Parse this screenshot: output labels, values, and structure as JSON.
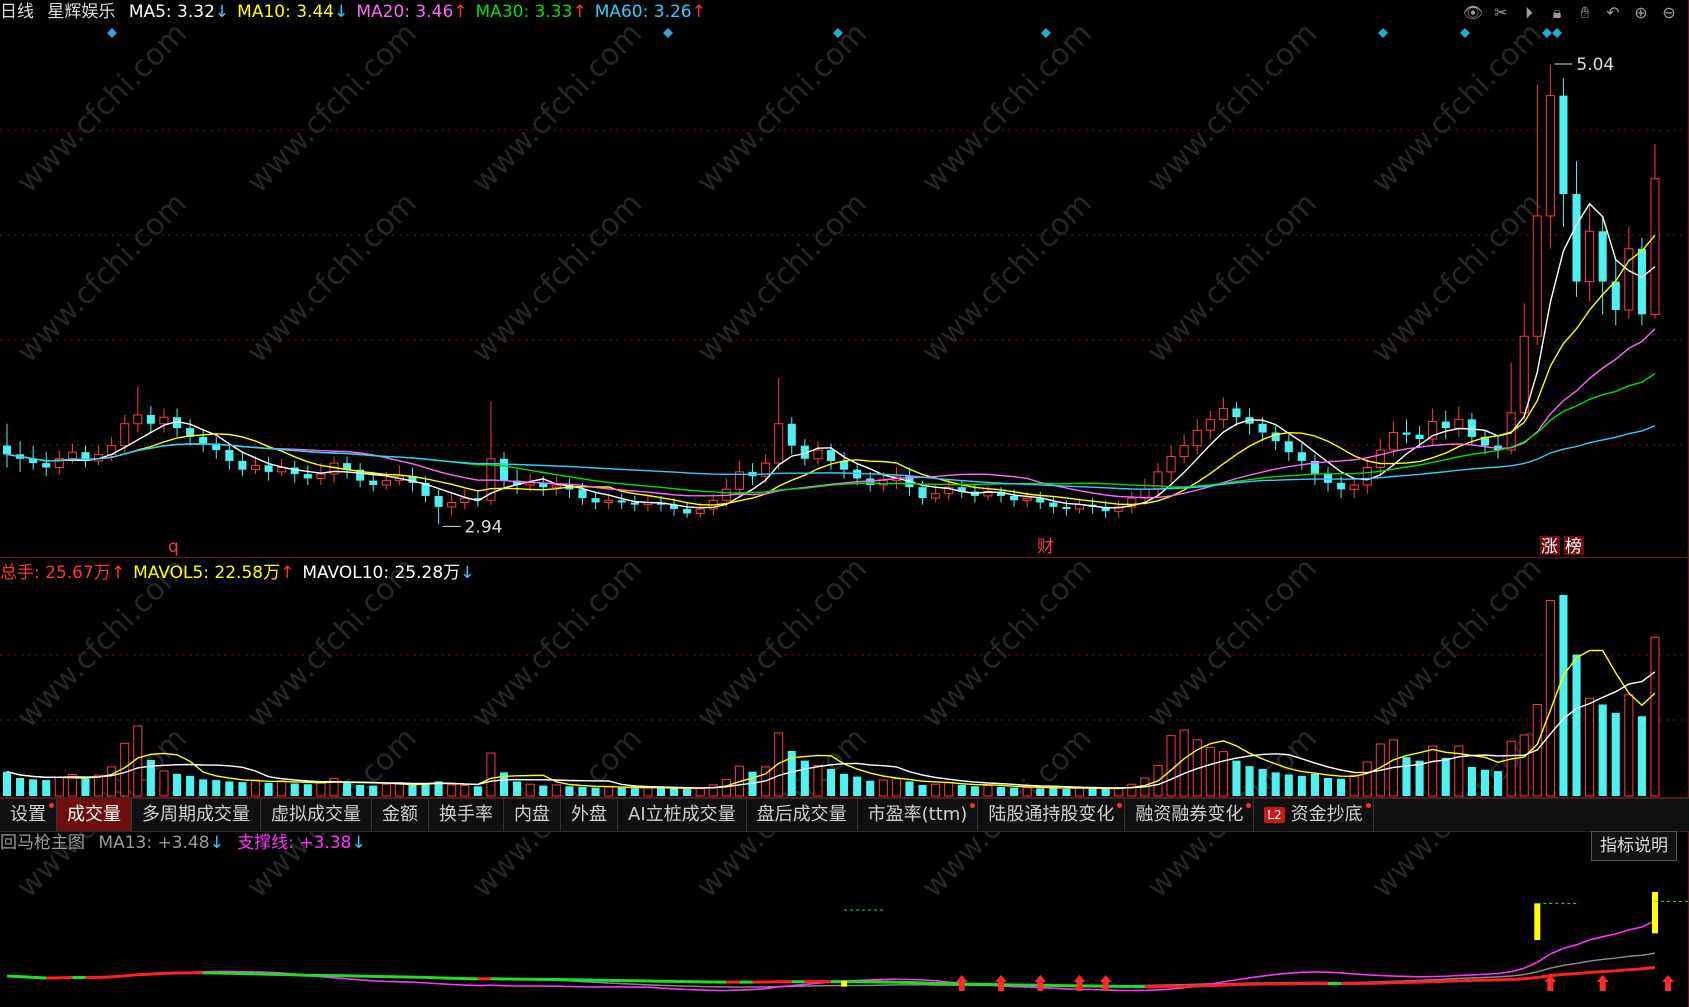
{
  "header": {
    "period": "日线",
    "stock_name": "星辉娱乐",
    "ma": [
      {
        "label": "MA5: 3.32",
        "arrow": "↓",
        "color": "#ffffff"
      },
      {
        "label": "MA10: 3.44",
        "arrow": "↓",
        "color": "#ffff00"
      },
      {
        "label": "MA20: 3.46",
        "arrow": "↑",
        "color": "#ff66ff"
      },
      {
        "label": "MA30: 3.33",
        "arrow": "↑",
        "color": "#00e000"
      },
      {
        "label": "MA60: 3.26",
        "arrow": "↑",
        "color": "#33ccff"
      }
    ],
    "tools": [
      "eye-icon",
      "scissors-icon",
      "play-icon",
      "lock-icon",
      "hand-icon",
      "undo-icon",
      "zoom-in-icon",
      "zoom-out-icon"
    ]
  },
  "price_annotations": {
    "high_label": "5.04",
    "low_label": "2.94",
    "marker_q": "q",
    "marker_cai": "财",
    "marker_zhang": "涨",
    "marker_bang": "榜"
  },
  "volume_legend": [
    {
      "label": "总手: 25.67万",
      "arrow": "↑",
      "color": "#ff3333"
    },
    {
      "label": "MAVOL5: 22.58万",
      "arrow": "↑",
      "color": "#ffff00"
    },
    {
      "label": "MAVOL10: 25.28万",
      "arrow": "↓",
      "color": "#ffffff"
    }
  ],
  "tabs": [
    {
      "label": "设置",
      "dot": true,
      "active": false
    },
    {
      "label": "成交量",
      "dot": false,
      "active": true
    },
    {
      "label": "多周期成交量",
      "dot": false,
      "active": false
    },
    {
      "label": "虚拟成交量",
      "dot": false,
      "active": false
    },
    {
      "label": "金额",
      "dot": false,
      "active": false
    },
    {
      "label": "换手率",
      "dot": false,
      "active": false
    },
    {
      "label": "内盘",
      "dot": false,
      "active": false
    },
    {
      "label": "外盘",
      "dot": false,
      "active": false
    },
    {
      "label": "AI立桩成交量",
      "dot": false,
      "active": false
    },
    {
      "label": "盘后成交量",
      "dot": false,
      "active": false
    },
    {
      "label": "市盈率(ttm)",
      "dot": true,
      "active": false
    },
    {
      "label": "陆股通持股变化",
      "dot": true,
      "active": false
    },
    {
      "label": "融资融券变化",
      "dot": true,
      "active": false
    },
    {
      "label": "资金抄底",
      "dot": true,
      "active": false,
      "badge": "L2"
    }
  ],
  "indicator": {
    "name": "回马枪主图",
    "ma13": "MA13: +3.48",
    "ma13_arrow": "↓",
    "support": "支撑线: +3.38",
    "support_arrow": "↓",
    "explain_button": "指标说明"
  },
  "watermark": "www.cfchi.com",
  "chart_data": {
    "type": "candlestick",
    "title": "星辉娱乐 日线",
    "price_range": [
      2.8,
      5.2
    ],
    "candles": [
      [
        3.3,
        3.26,
        3.4,
        3.2
      ],
      [
        3.26,
        3.24,
        3.32,
        3.18
      ],
      [
        3.24,
        3.22,
        3.3,
        3.19
      ],
      [
        3.22,
        3.2,
        3.27,
        3.16
      ],
      [
        3.2,
        3.24,
        3.28,
        3.17
      ],
      [
        3.24,
        3.27,
        3.31,
        3.22
      ],
      [
        3.27,
        3.23,
        3.3,
        3.2
      ],
      [
        3.23,
        3.26,
        3.3,
        3.21
      ],
      [
        3.26,
        3.3,
        3.34,
        3.23
      ],
      [
        3.3,
        3.4,
        3.44,
        3.26
      ],
      [
        3.4,
        3.44,
        3.57,
        3.36
      ],
      [
        3.44,
        3.4,
        3.48,
        3.36
      ],
      [
        3.4,
        3.43,
        3.47,
        3.36
      ],
      [
        3.43,
        3.38,
        3.47,
        3.34
      ],
      [
        3.38,
        3.34,
        3.42,
        3.3
      ],
      [
        3.34,
        3.31,
        3.37,
        3.27
      ],
      [
        3.31,
        3.28,
        3.34,
        3.24
      ],
      [
        3.28,
        3.23,
        3.31,
        3.19
      ],
      [
        3.23,
        3.19,
        3.27,
        3.16
      ],
      [
        3.19,
        3.21,
        3.25,
        3.17
      ],
      [
        3.21,
        3.18,
        3.25,
        3.14
      ],
      [
        3.18,
        3.2,
        3.24,
        3.16
      ],
      [
        3.2,
        3.17,
        3.23,
        3.13
      ],
      [
        3.17,
        3.15,
        3.21,
        3.12
      ],
      [
        3.15,
        3.17,
        3.22,
        3.12
      ],
      [
        3.17,
        3.22,
        3.25,
        3.13
      ],
      [
        3.22,
        3.19,
        3.25,
        3.15
      ],
      [
        3.19,
        3.14,
        3.22,
        3.11
      ],
      [
        3.14,
        3.12,
        3.18,
        3.09
      ],
      [
        3.12,
        3.14,
        3.18,
        3.1
      ],
      [
        3.14,
        3.16,
        3.21,
        3.12
      ],
      [
        3.16,
        3.13,
        3.2,
        3.09
      ],
      [
        3.13,
        3.07,
        3.16,
        3.04
      ],
      [
        3.07,
        3.02,
        3.1,
        2.94
      ],
      [
        3.02,
        3.04,
        3.08,
        2.98
      ],
      [
        3.04,
        3.06,
        3.1,
        3.01
      ],
      [
        3.06,
        3.05,
        3.09,
        3.02
      ],
      [
        3.05,
        3.24,
        3.5,
        3.03
      ],
      [
        3.24,
        3.14,
        3.27,
        3.1
      ],
      [
        3.14,
        3.12,
        3.19,
        3.08
      ],
      [
        3.12,
        3.13,
        3.17,
        3.09
      ],
      [
        3.13,
        3.11,
        3.16,
        3.07
      ],
      [
        3.11,
        3.12,
        3.16,
        3.07
      ],
      [
        3.12,
        3.1,
        3.15,
        3.06
      ],
      [
        3.1,
        3.06,
        3.13,
        3.03
      ],
      [
        3.06,
        3.04,
        3.09,
        3.01
      ],
      [
        3.04,
        3.05,
        3.08,
        3.01
      ],
      [
        3.05,
        3.04,
        3.08,
        3.01
      ],
      [
        3.04,
        3.03,
        3.07,
        3.0
      ],
      [
        3.03,
        3.04,
        3.07,
        3.0
      ],
      [
        3.04,
        3.03,
        3.07,
        3.0
      ],
      [
        3.03,
        3.01,
        3.06,
        2.98
      ],
      [
        3.01,
        2.99,
        3.04,
        2.97
      ],
      [
        2.99,
        3.01,
        3.04,
        2.97
      ],
      [
        3.01,
        3.05,
        3.08,
        2.98
      ],
      [
        3.05,
        3.1,
        3.15,
        3.02
      ],
      [
        3.1,
        3.18,
        3.23,
        3.06
      ],
      [
        3.18,
        3.16,
        3.22,
        3.12
      ],
      [
        3.16,
        3.22,
        3.26,
        3.13
      ],
      [
        3.22,
        3.4,
        3.61,
        3.19
      ],
      [
        3.4,
        3.3,
        3.43,
        3.26
      ],
      [
        3.3,
        3.24,
        3.33,
        3.21
      ],
      [
        3.24,
        3.28,
        3.32,
        3.21
      ],
      [
        3.28,
        3.23,
        3.31,
        3.19
      ],
      [
        3.23,
        3.19,
        3.27,
        3.15
      ],
      [
        3.19,
        3.15,
        3.22,
        3.12
      ],
      [
        3.15,
        3.12,
        3.18,
        3.09
      ],
      [
        3.12,
        3.14,
        3.18,
        3.09
      ],
      [
        3.14,
        3.16,
        3.2,
        3.1
      ],
      [
        3.16,
        3.11,
        3.2,
        3.07
      ],
      [
        3.11,
        3.06,
        3.14,
        3.03
      ],
      [
        3.06,
        3.08,
        3.12,
        3.04
      ],
      [
        3.08,
        3.11,
        3.15,
        3.05
      ],
      [
        3.11,
        3.09,
        3.14,
        3.06
      ],
      [
        3.09,
        3.07,
        3.12,
        3.04
      ],
      [
        3.07,
        3.09,
        3.12,
        3.05
      ],
      [
        3.09,
        3.07,
        3.11,
        3.04
      ],
      [
        3.07,
        3.05,
        3.1,
        3.02
      ],
      [
        3.05,
        3.06,
        3.09,
        3.02
      ],
      [
        3.06,
        3.04,
        3.09,
        3.01
      ],
      [
        3.04,
        3.02,
        3.07,
        2.99
      ],
      [
        3.02,
        3.01,
        3.05,
        2.98
      ],
      [
        3.01,
        3.03,
        3.06,
        2.99
      ],
      [
        3.03,
        3.02,
        3.06,
        2.99
      ],
      [
        3.02,
        3.0,
        3.05,
        2.97
      ],
      [
        3.0,
        3.02,
        3.05,
        2.97
      ],
      [
        3.02,
        3.06,
        3.09,
        2.99
      ],
      [
        3.06,
        3.1,
        3.15,
        3.03
      ],
      [
        3.1,
        3.18,
        3.22,
        3.07
      ],
      [
        3.18,
        3.25,
        3.3,
        3.13
      ],
      [
        3.25,
        3.3,
        3.35,
        3.22
      ],
      [
        3.3,
        3.37,
        3.42,
        3.26
      ],
      [
        3.37,
        3.42,
        3.46,
        3.33
      ],
      [
        3.42,
        3.47,
        3.52,
        3.38
      ],
      [
        3.47,
        3.43,
        3.5,
        3.39
      ],
      [
        3.43,
        3.4,
        3.47,
        3.35
      ],
      [
        3.4,
        3.36,
        3.43,
        3.32
      ],
      [
        3.36,
        3.32,
        3.39,
        3.28
      ],
      [
        3.32,
        3.27,
        3.35,
        3.23
      ],
      [
        3.27,
        3.23,
        3.31,
        3.19
      ],
      [
        3.23,
        3.17,
        3.26,
        3.12
      ],
      [
        3.17,
        3.13,
        3.2,
        3.09
      ],
      [
        3.13,
        3.1,
        3.16,
        3.06
      ],
      [
        3.1,
        3.12,
        3.15,
        3.06
      ],
      [
        3.12,
        3.2,
        3.24,
        3.08
      ],
      [
        3.2,
        3.28,
        3.33,
        3.16
      ],
      [
        3.28,
        3.36,
        3.41,
        3.25
      ],
      [
        3.36,
        3.35,
        3.42,
        3.31
      ],
      [
        3.35,
        3.33,
        3.39,
        3.29
      ],
      [
        3.33,
        3.41,
        3.47,
        3.3
      ],
      [
        3.41,
        3.38,
        3.46,
        3.33
      ],
      [
        3.38,
        3.42,
        3.48,
        3.34
      ],
      [
        3.42,
        3.34,
        3.45,
        3.3
      ],
      [
        3.34,
        3.3,
        3.37,
        3.26
      ],
      [
        3.3,
        3.28,
        3.34,
        3.24
      ],
      [
        3.28,
        3.45,
        3.68,
        3.26
      ],
      [
        3.45,
        3.8,
        3.95,
        3.42
      ],
      [
        3.8,
        4.35,
        4.95,
        3.76
      ],
      [
        4.35,
        4.9,
        5.04,
        4.2
      ],
      [
        4.9,
        4.45,
        4.98,
        4.3
      ],
      [
        4.45,
        4.05,
        4.6,
        3.98
      ],
      [
        4.05,
        4.28,
        4.4,
        3.96
      ],
      [
        4.28,
        4.05,
        4.35,
        3.9
      ],
      [
        4.05,
        3.92,
        4.15,
        3.85
      ],
      [
        3.92,
        4.2,
        4.3,
        3.88
      ],
      [
        4.2,
        3.9,
        4.25,
        3.85
      ],
      [
        3.9,
        4.52,
        4.68,
        3.88
      ]
    ],
    "volume_unit": "万",
    "volume_range": [
      0,
      30
    ],
    "volumes": [
      3.5,
      2.6,
      2.4,
      2.3,
      2.7,
      3.1,
      2.5,
      3.0,
      4.2,
      7.6,
      10.1,
      5.2,
      3.6,
      3.2,
      2.9,
      2.4,
      2.3,
      2.1,
      2.0,
      2.3,
      1.9,
      2.2,
      1.8,
      1.7,
      1.9,
      2.5,
      2.0,
      1.6,
      1.5,
      1.7,
      1.9,
      1.6,
      1.8,
      2.1,
      1.6,
      1.5,
      1.4,
      6.2,
      3.4,
      2.1,
      1.7,
      1.5,
      1.6,
      1.4,
      1.3,
      1.2,
      1.3,
      1.2,
      1.1,
      1.2,
      1.2,
      1.1,
      1.0,
      1.1,
      1.6,
      2.4,
      4.3,
      3.5,
      4.2,
      9.1,
      6.5,
      5.1,
      4.4,
      3.9,
      3.2,
      2.8,
      2.2,
      2.3,
      2.5,
      2.1,
      1.6,
      1.7,
      1.9,
      1.6,
      1.4,
      1.5,
      1.3,
      1.2,
      1.2,
      1.1,
      1.2,
      1.0,
      1.2,
      1.1,
      1.0,
      1.2,
      1.7,
      2.6,
      4.4,
      8.7,
      9.5,
      8.1,
      7.0,
      6.4,
      5.1,
      4.3,
      3.9,
      3.4,
      3.1,
      2.9,
      3.2,
      2.6,
      2.5,
      3.0,
      4.9,
      7.5,
      8.1,
      5.6,
      5.1,
      7.2,
      5.5,
      7.2,
      4.2,
      3.8,
      3.6,
      7.9,
      8.8,
      13.2,
      28.2,
      29.0,
      20.4,
      14.1,
      13.2,
      12.0,
      14.6,
      11.5,
      22.9
    ],
    "indicator_values": {
      "MA13": 3.48,
      "support": 3.38
    }
  }
}
